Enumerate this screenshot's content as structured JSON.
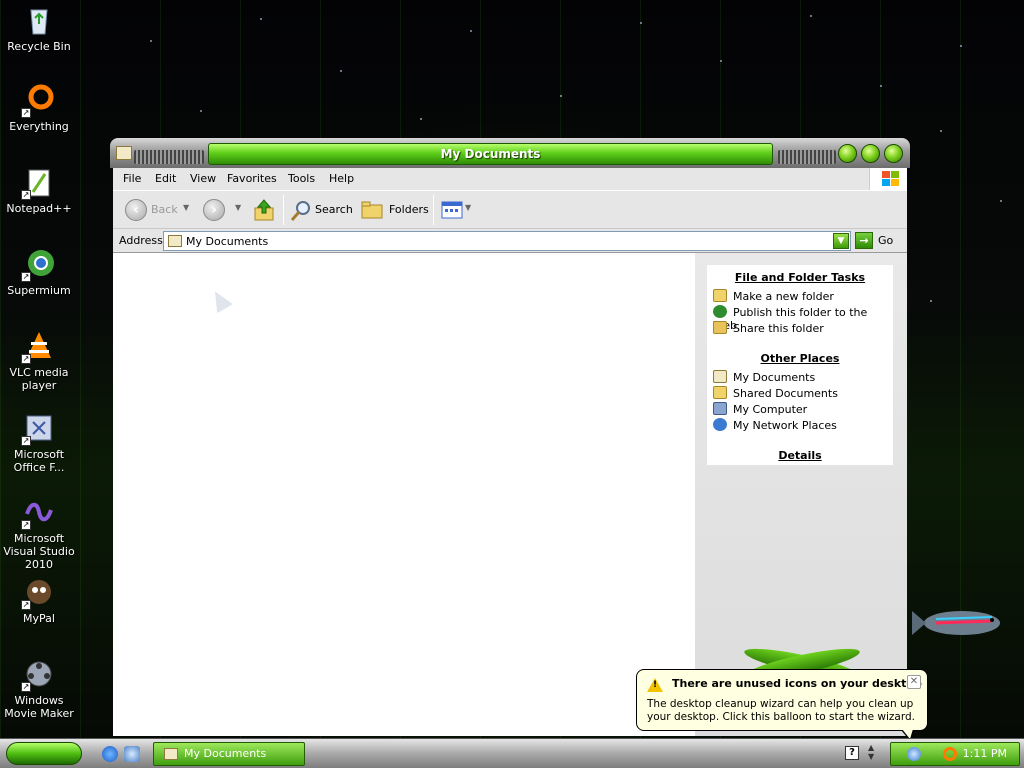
{
  "desktop": {
    "icons": [
      {
        "label": "Recycle Bin",
        "icon": "recycle-bin-icon"
      },
      {
        "label": "Everything",
        "icon": "everything-icon"
      },
      {
        "label": "Notepad++",
        "icon": "notepad-plus-plus-icon"
      },
      {
        "label": "Supermium",
        "icon": "supermium-icon"
      },
      {
        "label": "VLC media player",
        "icon": "vlc-icon"
      },
      {
        "label": "Microsoft Office F...",
        "icon": "office-icon"
      },
      {
        "label": "Microsoft Visual Studio 2010",
        "icon": "visual-studio-icon"
      },
      {
        "label": "MyPal",
        "icon": "mypal-icon"
      },
      {
        "label": "Windows Movie Maker",
        "icon": "movie-maker-icon"
      }
    ]
  },
  "window": {
    "title": "My Documents",
    "menu": [
      "File",
      "Edit",
      "View",
      "Favorites",
      "Tools",
      "Help"
    ],
    "toolbar": {
      "back": "Back",
      "search": "Search",
      "folders": "Folders"
    },
    "address": {
      "label": "Address",
      "value": "My Documents",
      "go": "Go"
    },
    "taskpane": {
      "file_tasks": {
        "title": "File and Folder Tasks",
        "items": [
          "Make a new folder",
          "Publish this folder to the Web",
          "Share this folder"
        ]
      },
      "other_places": {
        "title": "Other Places",
        "items": [
          "My Documents",
          "Shared Documents",
          "My Computer",
          "My Network Places"
        ]
      },
      "details": {
        "title": "Details"
      }
    }
  },
  "balloon": {
    "title": "There are unused icons on your desktop",
    "text": "The desktop cleanup wizard can help you clean up your desktop. Click this balloon to start the wizard."
  },
  "taskbar": {
    "task_button": "My Documents",
    "clock": "1:11 PM"
  },
  "colors": {
    "accent_green": "#4fbf13",
    "balloon_bg": "#ffffe1"
  }
}
